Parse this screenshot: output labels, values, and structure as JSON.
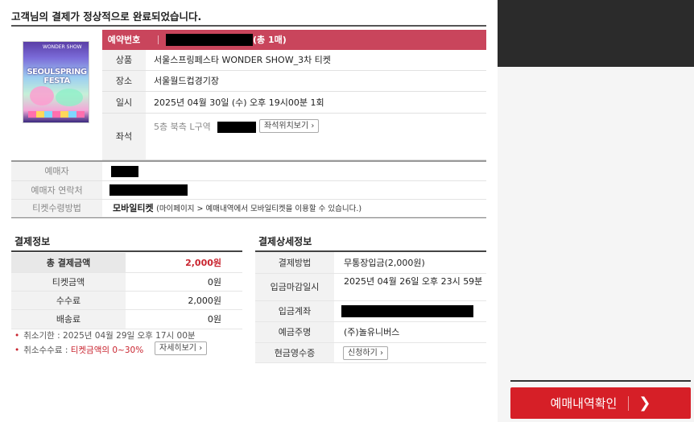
{
  "page_title": "고객님의 결제가 정상적으로 완료되었습니다.",
  "poster": {
    "alt": "SEOUL SPRING FESTA poster",
    "top_text": "WONDER SHOW",
    "main_text": "SEOULSPRING FESTA"
  },
  "reservation": {
    "number_label": "예약번호",
    "count_text": "(총 1매)",
    "rows": [
      {
        "label": "상품",
        "value": "서울스프링페스타 WONDER SHOW_3차 티켓"
      },
      {
        "label": "장소",
        "value": "서울월드컵경기장"
      },
      {
        "label": "일시",
        "value": "2025년 04월 30일 (수) 오후 19시00분 1회"
      }
    ],
    "seat_label": "좌석",
    "seat_value": "5층 북측 L구역",
    "seat_button": "좌석위치보기"
  },
  "buyer": {
    "rows": [
      {
        "label": "예매자"
      },
      {
        "label": "예매자 연락처"
      }
    ],
    "ticket_method_label": "티켓수령방법",
    "ticket_method_value": "모바일티켓",
    "ticket_method_note": "(마이페이지 > 예매내역에서 모바일티켓을 이용할 수 있습니다.)"
  },
  "payment": {
    "title": "결제정보",
    "rows": [
      {
        "label": "총 결제금액",
        "value": "2,000원"
      },
      {
        "label": "티켓금액",
        "value": "0원"
      },
      {
        "label": "수수료",
        "value": "2,000원"
      },
      {
        "label": "배송료",
        "value": "0원"
      }
    ],
    "cancel_deadline": "취소기한 : 2025년 04월 29일 오후 17시 00분",
    "cancel_fee_prefix": "취소수수료 : ",
    "cancel_fee_value": "티켓금액의 0~30%",
    "details_button": "자세히보기"
  },
  "payment_detail": {
    "title": "결제상세정보",
    "rows": [
      {
        "label": "결제방법",
        "value": "무통장입금(2,000원)"
      },
      {
        "label": "입금마감일시",
        "value": "2025년 04월 26일 오후 23시 59분"
      },
      {
        "label": "입금계좌",
        "value": ""
      },
      {
        "label": "예금주명",
        "value": "(주)놀유니버스"
      },
      {
        "label": "현금영수증",
        "value": ""
      }
    ],
    "receipt_button": "신청하기"
  },
  "confirm_button": "예매내역확인",
  "colors": {
    "accent": "#c9455c",
    "confirm": "#d61f27",
    "price_red": "#c9242f"
  }
}
